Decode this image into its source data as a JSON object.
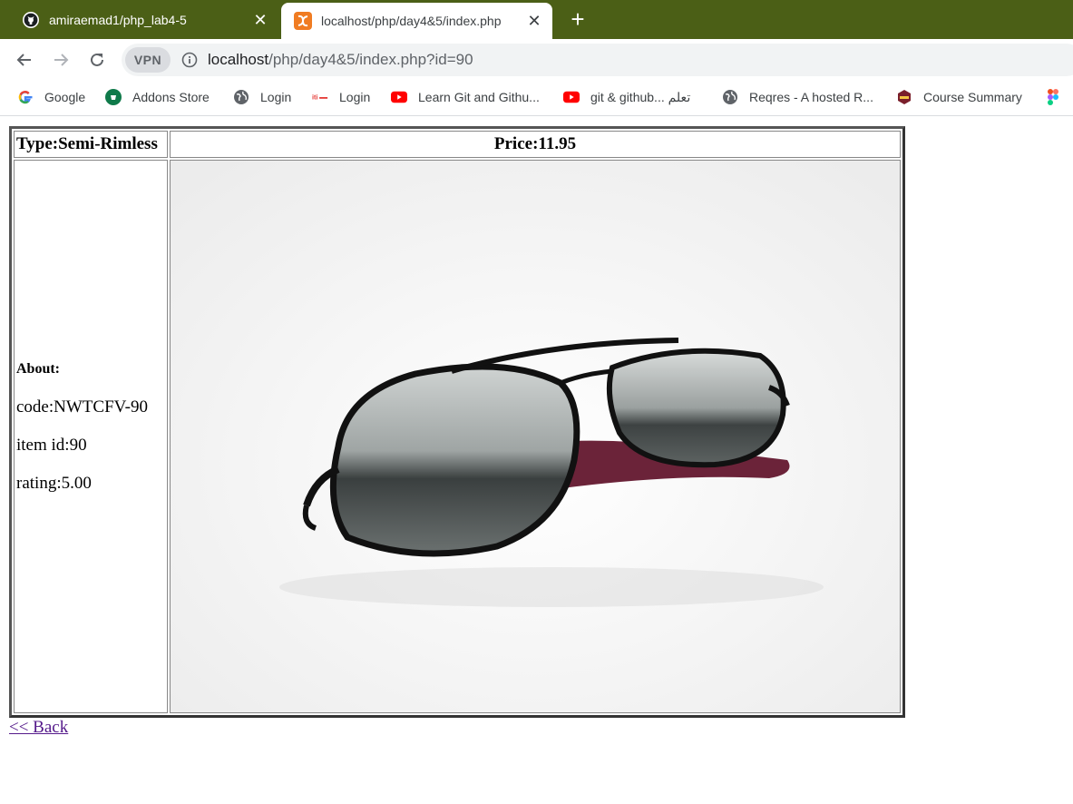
{
  "browser": {
    "tabs": [
      {
        "title": "amiraemad1/php_lab4-5",
        "icon": "github-icon",
        "active": false
      },
      {
        "title": "localhost/php/day4&5/index.php",
        "icon": "xampp-icon",
        "active": true
      }
    ],
    "new_tab_symbol": "+",
    "close_symbol": "✕",
    "vpn_label": "VPN",
    "url_host": "localhost",
    "url_path": "/php/day4&5/index.php?id=90",
    "bookmarks": [
      {
        "label": "Google",
        "icon": "google-icon"
      },
      {
        "label": "Addons Store",
        "icon": "addons-store-icon"
      },
      {
        "label": "Login",
        "icon": "globe-icon"
      },
      {
        "label": "Login",
        "icon": "iti-icon"
      },
      {
        "label": "Learn Git and Githu...",
        "icon": "youtube-icon"
      },
      {
        "label": "git & github... تعلم",
        "icon": "youtube-icon"
      },
      {
        "label": "Reqres - A hosted R...",
        "icon": "globe-icon"
      },
      {
        "label": "Course Summary",
        "icon": "course-icon"
      }
    ]
  },
  "product": {
    "type_text": "Type:Semi-Rimless",
    "price_text": "Price:11.95",
    "about_label": "About:",
    "code_text": "code:NWTCFV-90",
    "item_id_text": "item id:90",
    "rating_text": "rating:5.00",
    "image_icon": "sunglasses-image"
  },
  "back_link": "<< Back",
  "colors": {
    "tabbar": "#4b5f16",
    "link_visited": "#551a8b"
  }
}
